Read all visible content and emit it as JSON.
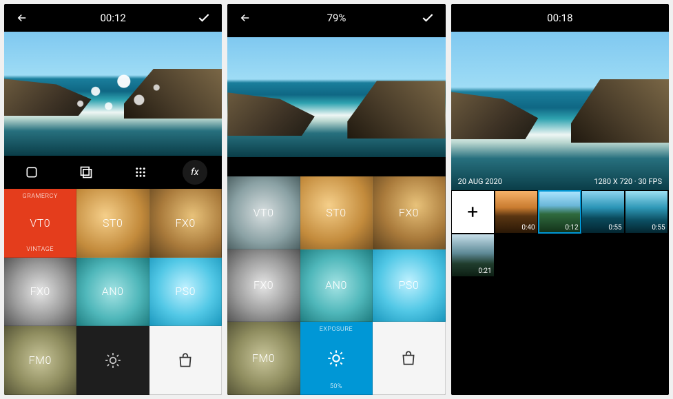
{
  "screen1": {
    "topbar": {
      "time": "00:12"
    },
    "toolbar": {
      "icons": [
        "aspect",
        "layers",
        "grid",
        "fx"
      ]
    },
    "filters": {
      "row1": [
        {
          "code": "VT0",
          "topLabel": "GRAMERCY",
          "bottomLabel": "VINTAGE",
          "selected": true
        },
        {
          "code": "ST0"
        },
        {
          "code": "FX0"
        }
      ],
      "row2": [
        {
          "code": "FX0"
        },
        {
          "code": "AN0"
        },
        {
          "code": "PS0"
        }
      ],
      "row3": [
        {
          "code": "FM0"
        },
        {
          "icon": "brightness"
        },
        {
          "icon": "shop"
        }
      ]
    }
  },
  "screen2": {
    "topbar": {
      "progress": "79%"
    },
    "filters": {
      "row1": [
        {
          "code": "VT0"
        },
        {
          "code": "ST0"
        },
        {
          "code": "FX0"
        }
      ],
      "row2": [
        {
          "code": "FX0"
        },
        {
          "code": "AN0"
        },
        {
          "code": "PS0"
        }
      ],
      "row3": [
        {
          "code": "FM0"
        },
        {
          "topLabel": "EXPOSURE",
          "bottomLabel": "50%",
          "icon": "brightness",
          "selectedBlue": true
        },
        {
          "icon": "shop"
        }
      ]
    }
  },
  "screen3": {
    "topbar": {
      "time": "00:18"
    },
    "meta": {
      "date": "20 AUG 2020",
      "resfps": "1280 X 720 · 30 FPS"
    },
    "clips": [
      {
        "type": "add",
        "label": "+"
      },
      {
        "duration": "0:40"
      },
      {
        "duration": "0:12",
        "selected": true
      },
      {
        "duration": "0:55"
      },
      {
        "duration": "0:55"
      },
      {
        "duration": "0:21"
      }
    ]
  }
}
